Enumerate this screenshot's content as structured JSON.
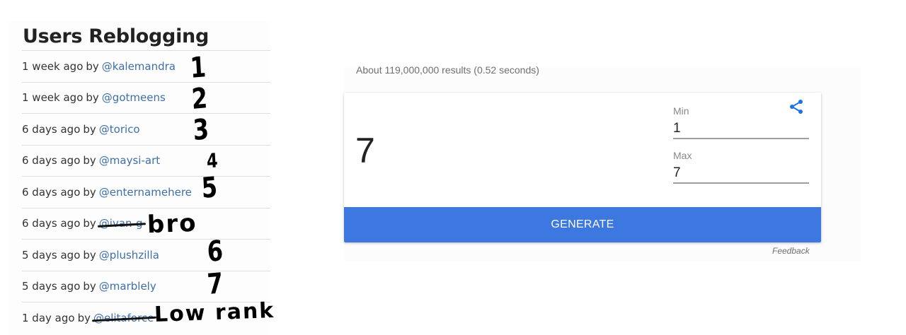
{
  "reblog_panel": {
    "title": "Users Reblogging",
    "by_word": "by",
    "rows": [
      {
        "when": "1 week ago",
        "user": "@kalemandra",
        "struck": false
      },
      {
        "when": "1 week ago",
        "user": "@gotmeens",
        "struck": false
      },
      {
        "when": "6 days ago",
        "user": "@torico",
        "struck": false
      },
      {
        "when": "6 days ago",
        "user": "@maysi-art",
        "struck": false
      },
      {
        "when": "6 days ago",
        "user": "@enternamehere",
        "struck": false
      },
      {
        "when": "6 days ago",
        "user": "@ivan-g",
        "struck": true
      },
      {
        "when": "5 days ago",
        "user": "@plushzilla",
        "struck": false
      },
      {
        "when": "5 days ago",
        "user": "@marblely",
        "struck": false
      },
      {
        "when": "1 day ago",
        "user": "@elitaforce",
        "struck": true
      }
    ],
    "annotations": [
      "1",
      "2",
      "3",
      "4",
      "5",
      "bro",
      "6",
      "7",
      "Low rank"
    ]
  },
  "search": {
    "result_stats": "About 119,000,000 results (0.52 seconds)"
  },
  "random_number_generator": {
    "result": "7",
    "min_label": "Min",
    "min_value": "1",
    "max_label": "Max",
    "max_value": "7",
    "generate_label": "GENERATE",
    "share_icon": "share-icon",
    "feedback_label": "Feedback"
  },
  "colors": {
    "link": "#3d6fa8",
    "generate_button": "#3c78e0",
    "share_icon": "#1a73e8"
  }
}
